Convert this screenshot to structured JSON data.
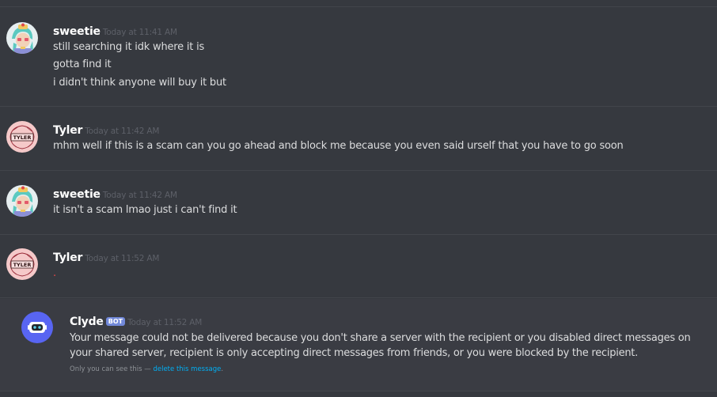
{
  "messages": [
    {
      "author": "sweetie",
      "timestamp": "Today at 11:41 AM",
      "lines": [
        "still searching it idk where it is",
        "gotta find it",
        "i didn't think anyone will buy it but"
      ]
    },
    {
      "author": "Tyler",
      "timestamp": "Today at 11:42 AM",
      "lines": [
        "mhm well if this is a scam can you go ahead and block me because you even said urself that you have to go soon"
      ]
    },
    {
      "author": "sweetie",
      "timestamp": "Today at 11:42 AM",
      "lines": [
        "it isn't a scam lmao just i can't find it"
      ]
    },
    {
      "author": "Tyler",
      "timestamp": "Today at 11:52 AM",
      "lines": [
        "."
      ]
    }
  ],
  "bot_message": {
    "author": "Clyde",
    "tag": "BOT",
    "timestamp": "Today at 11:52 AM",
    "text": "Your message could not be delivered because you don't share a server with the recipient or you disabled direct messages on your shared server, recipient is only accepting direct messages from friends, or you were blocked by the recipient.",
    "notice": "Only you can see this — ",
    "notice_link": "delete this message",
    "notice_end": "."
  },
  "avatar_text": "TYLER",
  "colors": {
    "background": "#36393f",
    "ephemeral_bg": "#3a3c43",
    "bot_tag": "#7289da",
    "link": "#00aff4",
    "clyde_avatar": "#5865f2"
  },
  "icons": {
    "sweetie_avatar": "anime-character-avatar",
    "tyler_avatar": "tyler-doodle-avatar",
    "clyde_avatar": "clyde-robot-icon"
  }
}
